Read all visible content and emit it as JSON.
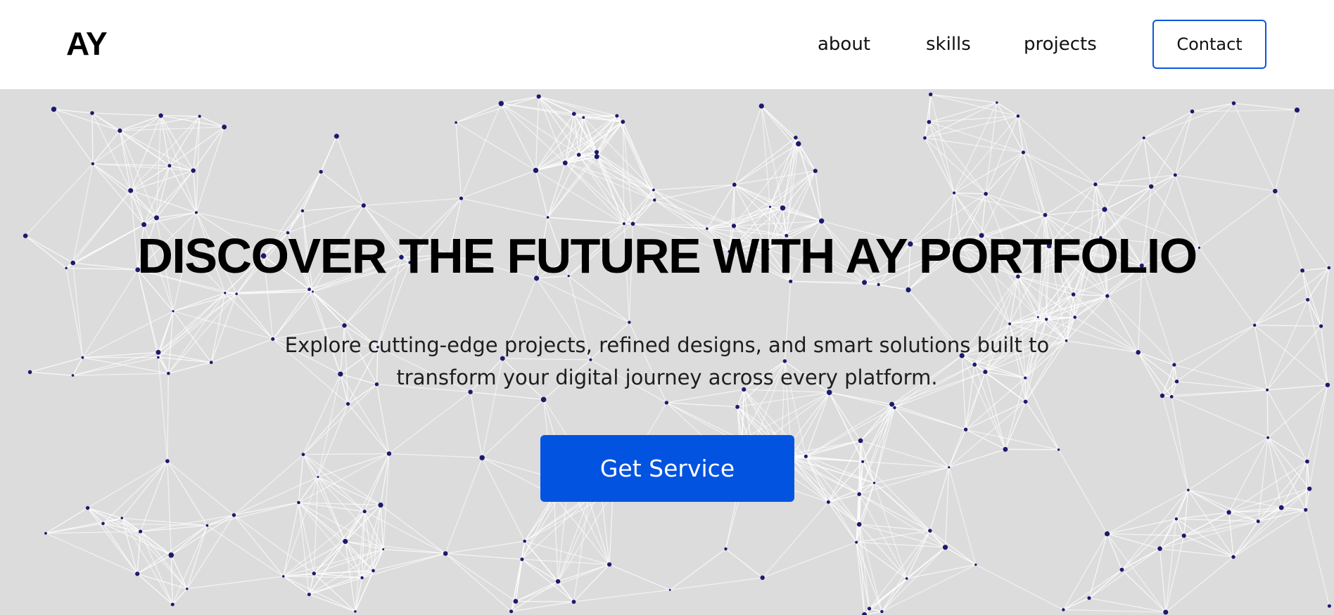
{
  "header": {
    "logo": "AY",
    "nav": {
      "about": "about",
      "skills": "skills",
      "projects": "projects"
    },
    "contact_label": "Contact"
  },
  "hero": {
    "title": "DISCOVER THE FUTURE WITH AY PORTFOLIO",
    "description": "Explore cutting-edge projects, refined designs, and smart solutions built to transform your digital journey across every platform.",
    "cta_label": "Get Service",
    "background_graphic": "particle-network"
  },
  "colors": {
    "accent": "#0353e1",
    "contact_border": "#0a56e0",
    "hero_background": "#dcdcdc",
    "network_line": "#ffffff",
    "network_node": "#1c1a6e"
  }
}
